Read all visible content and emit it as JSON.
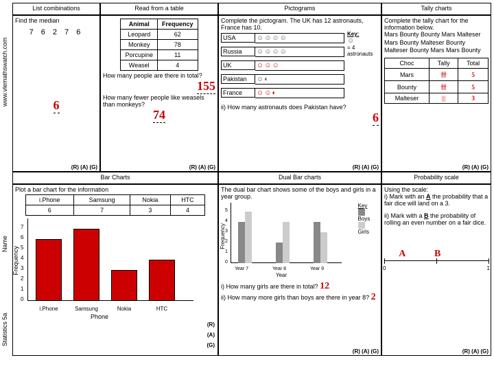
{
  "sidebar": {
    "website": "www.vlemathswatch.com",
    "name_label": "Name",
    "sheet_label": "Statistics 5a"
  },
  "headers": {
    "h1": "List combinations",
    "h2": "Read from a table",
    "h3": "Pictograms",
    "h4": "Tally charts",
    "h5": "Bar Charts",
    "h6": "Dual Bar charts",
    "h7": "Probability scale"
  },
  "median": {
    "prompt": "Find the median",
    "numbers": "7  6  2  7  6",
    "answer": "6"
  },
  "animal_table": {
    "col1": "Animal",
    "col2": "Frequency",
    "rows": [
      {
        "a": "Leopard",
        "f": "62"
      },
      {
        "a": "Monkey",
        "f": "78"
      },
      {
        "a": "Porcupine",
        "f": "11"
      },
      {
        "a": "Weasel",
        "f": "4"
      }
    ],
    "q1": "How many people are there in total?",
    "a1": "155",
    "q2": "How many fewer people like weasels than monkeys?",
    "a2": "74"
  },
  "picto": {
    "prompt": "Complete the pictogram. The UK has 12 astronauts, France has 10.",
    "rows": [
      "USA",
      "Russia",
      "UK",
      "Pakistan",
      "France"
    ],
    "key_label": "Key:",
    "key_text": "= 4 astronauts",
    "q2": "ii) How many astronauts does Pakistan have?",
    "a2": "6"
  },
  "tally": {
    "prompt": "Complete the tally chart for the information below.",
    "items": "Mars  Bounty  Bounty Mars Malteser  Mars   Bounty Malteser Bounty Malteser Bounty Mars  Mars Bounty",
    "cols": {
      "c1": "Choc",
      "c2": "Tally",
      "c3": "Total"
    },
    "rows": [
      {
        "c": "Mars",
        "tot": "5"
      },
      {
        "c": "Bounty",
        "tot": "5"
      },
      {
        "c": "Malteser",
        "tot": "3"
      }
    ]
  },
  "bar": {
    "prompt": "Plot a bar chart for the information",
    "cols": [
      "i.Phone",
      "Samsung",
      "Nokia",
      "HTC"
    ],
    "vals": [
      "6",
      "7",
      "3",
      "4"
    ],
    "ylabel": "Frequency",
    "xlabel": "Phone"
  },
  "dual": {
    "prompt": "The dual bar chart shows some of the boys and girls in a year group.",
    "key": "Key",
    "boys": "Boys",
    "girls": "Girls",
    "years": [
      "Year 7",
      "Year 8",
      "Year 9"
    ],
    "ylabel": "Frequency",
    "xlabel": "Year",
    "q1": "i) How many girls are there in total?",
    "a1": "12",
    "q2": "ii) How many more girls than boys are there in year 8?",
    "a2": "2"
  },
  "prob": {
    "prompt1": "Using the scale:",
    "prompt2": "i) Mark with an",
    "prompt2b": "the probability that a fair dice will land on a 3.",
    "A": "A",
    "prompt3": "ii) Mark with a",
    "prompt3b": "the probability of rolling an even number on a fair dice.",
    "B": "B",
    "markA": "A",
    "markB": "B",
    "s0": "0",
    "s1": "1"
  },
  "rag": "(R) (A) (G)",
  "chart_data": [
    {
      "type": "bar",
      "title": "Phone bar chart",
      "categories": [
        "i.Phone",
        "Samsung",
        "Nokia",
        "HTC"
      ],
      "values": [
        6,
        7,
        3,
        4
      ],
      "xlabel": "Phone",
      "ylabel": "Frequency",
      "ylim": [
        0,
        7
      ]
    },
    {
      "type": "bar",
      "title": "Dual bar chart boys/girls by year",
      "categories": [
        "Year 7",
        "Year 8",
        "Year 9"
      ],
      "series": [
        {
          "name": "Boys",
          "values": [
            4,
            2,
            4
          ]
        },
        {
          "name": "Girls",
          "values": [
            5,
            4,
            3
          ]
        }
      ],
      "xlabel": "Year",
      "ylabel": "Frequency",
      "ylim": [
        0,
        5
      ]
    }
  ]
}
